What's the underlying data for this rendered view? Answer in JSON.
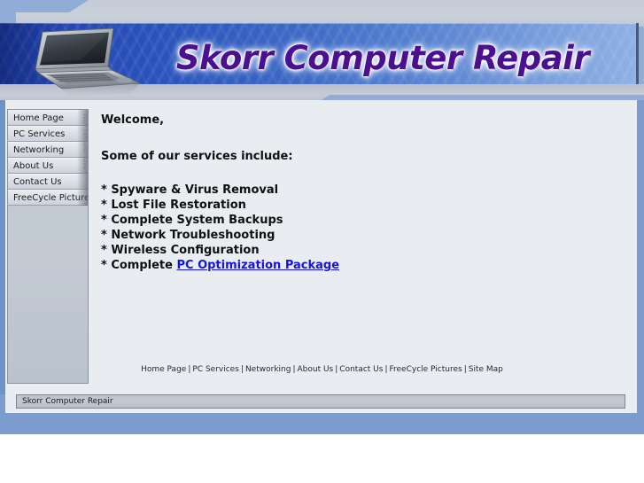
{
  "site": {
    "title": "Skorr Computer Repair",
    "banner_icon": "laptop-icon",
    "title_color": "#4a1090",
    "banner_color_left": "#1f3fa8",
    "banner_color_right": "#8fb0e4",
    "page_background": "#7b9ccd",
    "content_background": "#e9edf1"
  },
  "sidebar": {
    "items": [
      {
        "label": "Home Page"
      },
      {
        "label": "PC Services"
      },
      {
        "label": "Networking"
      },
      {
        "label": "About Us"
      },
      {
        "label": "Contact Us"
      },
      {
        "label": "FreeCycle Pictures"
      }
    ],
    "gutter_label": "Skorr Computer Repair"
  },
  "main": {
    "welcome": "Welcome,",
    "lead": "Some of our services include:",
    "services": [
      {
        "prefix": "* Spyware & Virus Removal",
        "link": "",
        "suffix": ""
      },
      {
        "prefix": "* Lost File Restoration",
        "link": "",
        "suffix": ""
      },
      {
        "prefix": "* Complete System Backups",
        "link": "",
        "suffix": ""
      },
      {
        "prefix": "* Network Troubleshooting",
        "link": "",
        "suffix": ""
      },
      {
        "prefix": "* Wireless Configuration",
        "link": "",
        "suffix": ""
      },
      {
        "prefix": "* Complete ",
        "link": "PC Optimization Package",
        "suffix": ""
      }
    ],
    "link_color": "#1414e8"
  },
  "footer": {
    "links": [
      "Home Page",
      "PC Services",
      "Networking",
      "About Us",
      "Contact Us",
      "FreeCycle Pictures",
      "Site Map"
    ],
    "separator": "|"
  },
  "statusbar": {
    "text": "Skorr Computer Repair"
  }
}
